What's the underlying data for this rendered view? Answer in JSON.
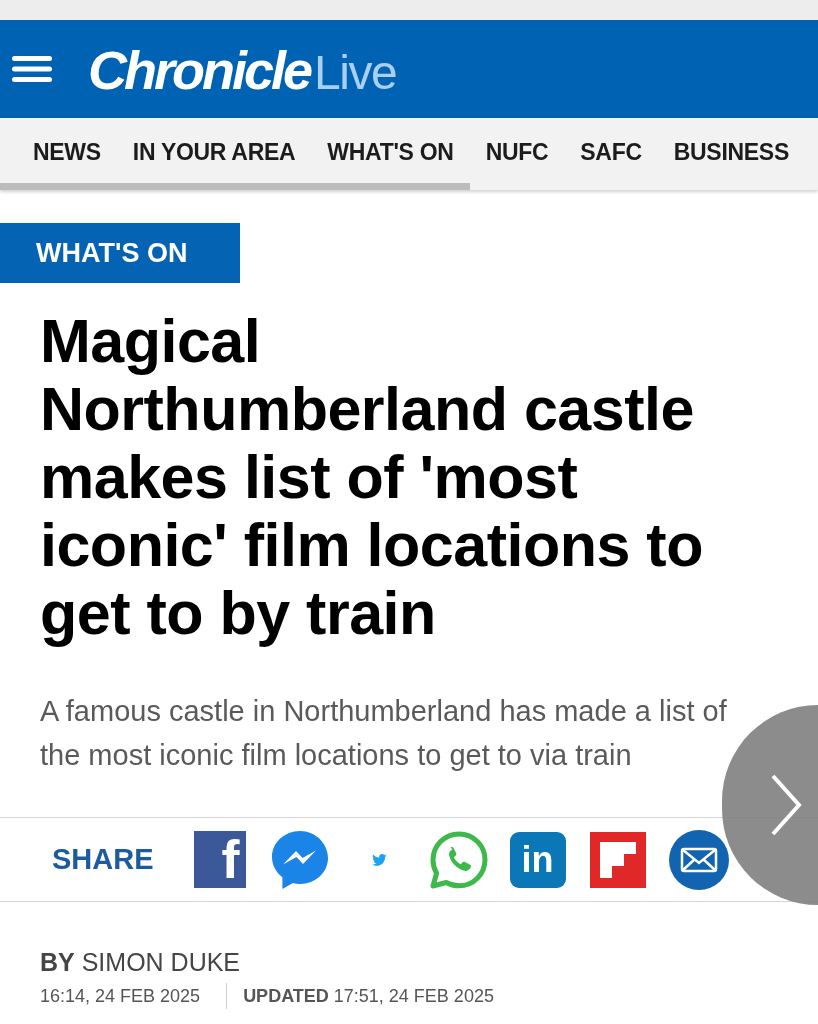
{
  "header": {
    "logo": {
      "main": "Chronicle",
      "accent": "Live"
    }
  },
  "nav": {
    "items": [
      {
        "label": "NEWS"
      },
      {
        "label": "IN YOUR AREA"
      },
      {
        "label": "WHAT'S ON"
      },
      {
        "label": "NUFC"
      },
      {
        "label": "SAFC"
      },
      {
        "label": "BUSINESS"
      }
    ]
  },
  "section_tag": "WHAT'S ON",
  "article": {
    "headline": "Magical Northumberland castle makes list of 'most iconic' film locations to get to by train",
    "standfirst": "A famous castle in Northumberland has made a list of the most iconic film locations to get to via train",
    "share": {
      "label": "SHARE",
      "buttons": [
        {
          "kind": "facebook",
          "glyph": "f"
        },
        {
          "kind": "messenger"
        },
        {
          "kind": "twitter"
        },
        {
          "kind": "whatsapp"
        },
        {
          "kind": "linkedin",
          "glyph": "in"
        },
        {
          "kind": "flipboard"
        },
        {
          "kind": "email"
        }
      ]
    },
    "byline": "**BY** SIMON DUKE",
    "published": "16:14, 24 FEB 2025",
    "updated": "**UPDATED** 17:51, 24 FEB 2025"
  }
}
